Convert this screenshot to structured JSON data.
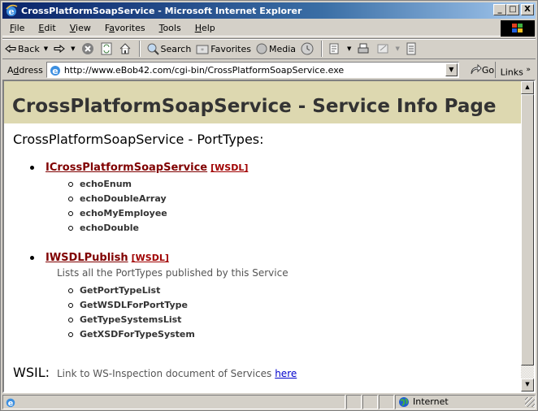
{
  "window": {
    "title": "CrossPlatformSoapService - Microsoft Internet Explorer",
    "buttons": {
      "minimize": "_",
      "maximize": "□",
      "close": "X"
    }
  },
  "menubar": {
    "items": [
      {
        "label": "File",
        "accel": "F",
        "rest": "ile"
      },
      {
        "label": "Edit",
        "accel": "E",
        "rest": "dit"
      },
      {
        "label": "View",
        "accel": "V",
        "rest": "iew"
      },
      {
        "label": "Favorites",
        "pre": "F",
        "accel": "a",
        "rest": "vorites"
      },
      {
        "label": "Tools",
        "accel": "T",
        "rest": "ools"
      },
      {
        "label": "Help",
        "accel": "H",
        "rest": "elp"
      }
    ]
  },
  "toolbar": {
    "back_label": "Back",
    "search_label": "Search",
    "favorites_label": "Favorites",
    "media_label": "Media"
  },
  "address": {
    "label_pre": "A",
    "label_accel": "d",
    "label_rest": "dress",
    "url": "http://www.eBob42.com/cgi-bin/CrossPlatformSoapService.exe",
    "go_label": "Go",
    "links_label": "Links",
    "links_chevron": "»"
  },
  "page": {
    "banner_title": "CrossPlatformSoapService - Service Info Page",
    "porttypes_heading": "CrossPlatformSoapService - PortTypes:",
    "porttypes": [
      {
        "name": "ICrossPlatformSoapService",
        "wsdl_label": "[WSDL]",
        "description": "",
        "operations": [
          "echoEnum",
          "echoDoubleArray",
          "echoMyEmployee",
          "echoDouble"
        ]
      },
      {
        "name": "IWSDLPublish",
        "wsdl_label": "[WSDL]",
        "description": "Lists all the PortTypes published by this Service",
        "operations": [
          "GetPortTypeList",
          "GetWSDLForPortType",
          "GetTypeSystemsList",
          "GetXSDForTypeSystem"
        ]
      }
    ],
    "wsil_label": "WSIL:",
    "wsil_text": "Link to WS-Inspection document of Services",
    "wsil_link": "here"
  },
  "statusbar": {
    "zone_label": "Internet"
  },
  "colors": {
    "banner_bg": "#ddd8b0",
    "porttype_link": "#800000",
    "wsdl_link": "#a00000",
    "hyperlink": "#0000cc",
    "titlebar_start": "#0a246a"
  }
}
